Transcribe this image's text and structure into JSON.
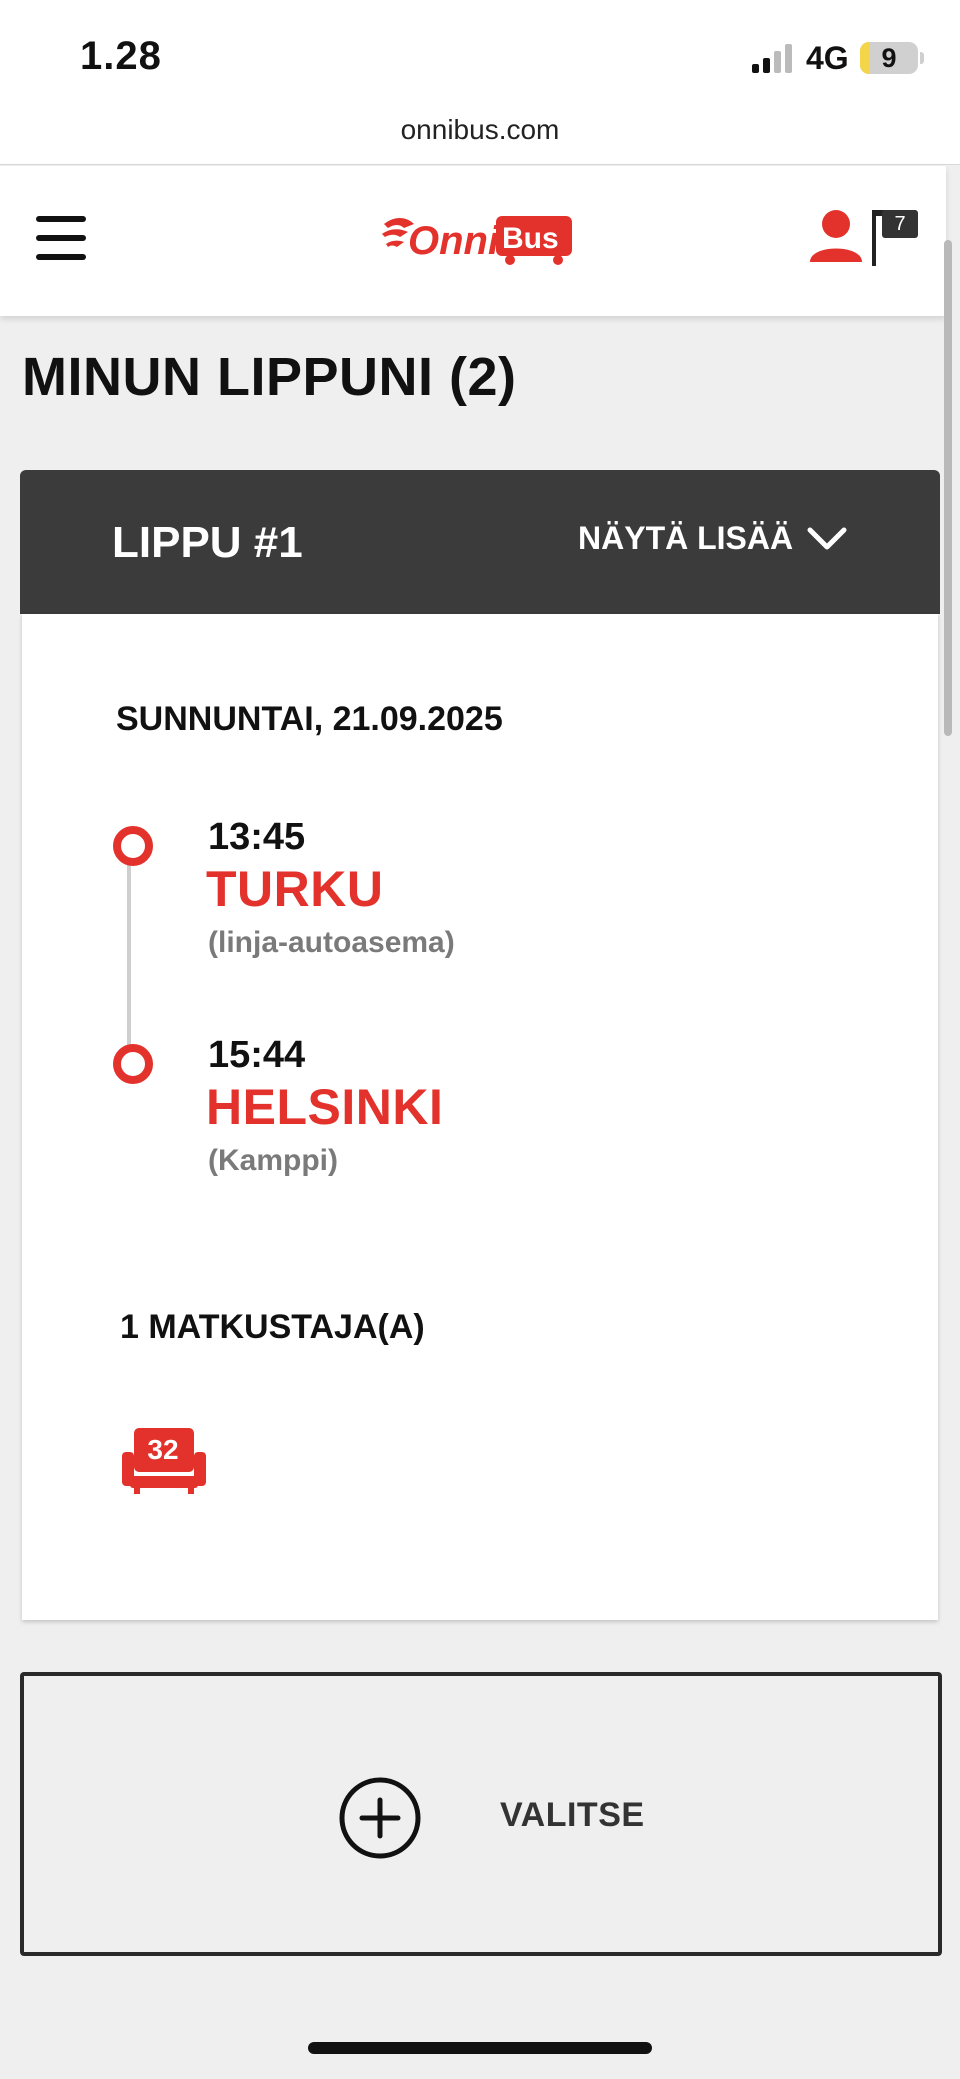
{
  "status_bar": {
    "time": "1.28",
    "network": "4G",
    "battery": "9"
  },
  "browser": {
    "url": "onnibus.com"
  },
  "header": {
    "logo_text": "OnniBus",
    "cart_count": "7"
  },
  "page": {
    "title": "MINUN LIPPUNI (2)"
  },
  "ticket": {
    "label": "LIPPU #1",
    "show_more": "NÄYTÄ LISÄÄ",
    "date": "SUNNUNTAI, 21.09.2025",
    "departure": {
      "time": "13:45",
      "city": "TURKU",
      "station": "(linja-autoasema)"
    },
    "arrival": {
      "time": "15:44",
      "city": "HELSINKI",
      "station": "(Kamppi)"
    },
    "passengers": "1 MATKUSTAJA(A)",
    "seat": "32"
  },
  "select": {
    "label": "VALITSE"
  },
  "colors": {
    "brand_red": "#e3322b",
    "header_dark": "#3b3b3b"
  }
}
